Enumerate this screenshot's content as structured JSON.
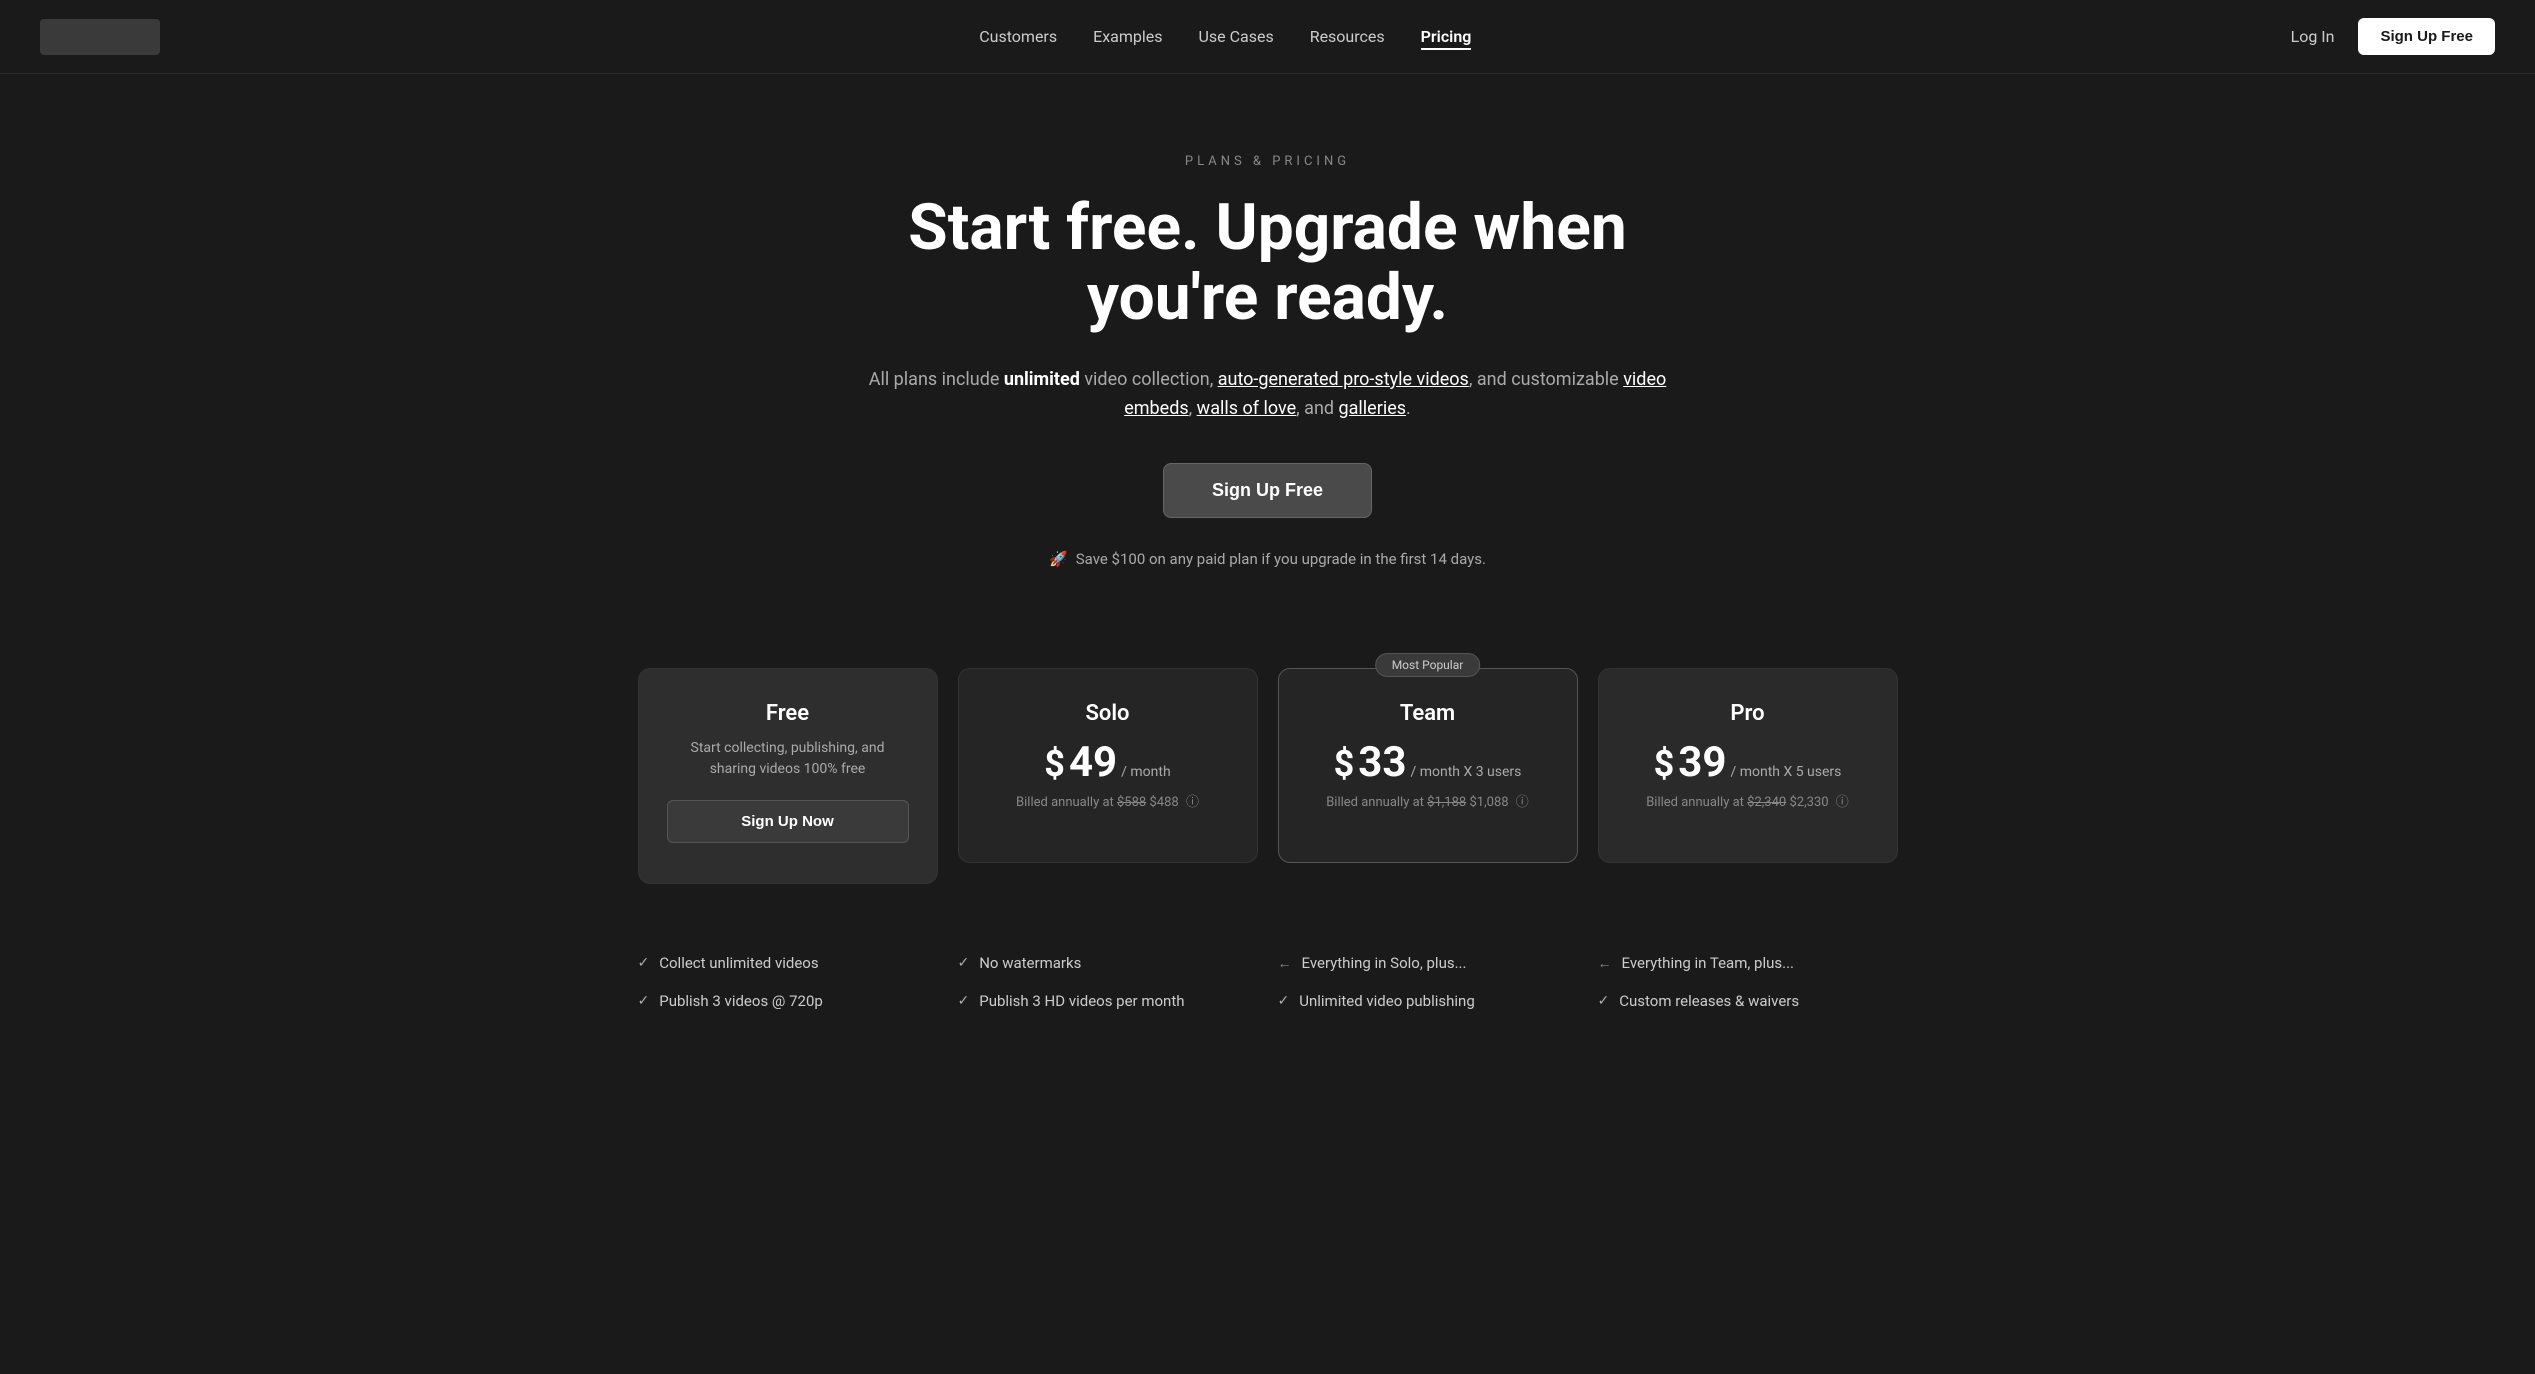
{
  "nav": {
    "logo_alt": "Logo",
    "links": [
      {
        "label": "Customers",
        "active": false
      },
      {
        "label": "Examples",
        "active": false
      },
      {
        "label": "Use Cases",
        "active": false
      },
      {
        "label": "Resources",
        "active": false
      },
      {
        "label": "Pricing",
        "active": true
      }
    ],
    "login_label": "Log In",
    "signup_label": "Sign Up Free"
  },
  "hero": {
    "label": "PLANS & PRICING",
    "title": "Start free. Upgrade when you're ready.",
    "subtitle_plain": "All plans include ",
    "subtitle_bold": "unlimited",
    "subtitle_mid": " video collection, ",
    "subtitle_link1": "auto-generated pro-style videos",
    "subtitle_comma1": ", and customizable ",
    "subtitle_link2": "video embeds",
    "subtitle_comma2": ", ",
    "subtitle_link3": "walls of love",
    "subtitle_comma3": ", and ",
    "subtitle_link4": "galleries",
    "subtitle_end": ".",
    "cta_label": "Sign Up Free",
    "save_note": "Save $100 on any paid plan if you upgrade in the first 14 days.",
    "rocket_emoji": "🚀"
  },
  "pricing": {
    "cards": [
      {
        "id": "free",
        "title": "Free",
        "description": "Start collecting, publishing, and sharing videos 100% free",
        "cta_label": "Sign Up Now",
        "has_price": false,
        "badge": null,
        "billing": null
      },
      {
        "id": "solo",
        "title": "Solo",
        "description": null,
        "cta_label": null,
        "has_price": true,
        "price_amount": "49",
        "price_dollar": "$",
        "price_per": "/ month",
        "badge": null,
        "billing_original": "$588",
        "billing_discounted": "$488",
        "billing_prefix": "Billed annually at "
      },
      {
        "id": "team",
        "title": "Team",
        "description": null,
        "cta_label": null,
        "has_price": true,
        "price_amount": "33",
        "price_dollar": "$",
        "price_per": "/ month X 3 users",
        "badge": "Most Popular",
        "billing_original": "$1,188",
        "billing_discounted": "$1,088",
        "billing_prefix": "Billed annually at "
      },
      {
        "id": "pro",
        "title": "Pro",
        "description": null,
        "cta_label": null,
        "has_price": true,
        "price_amount": "39",
        "price_dollar": "$",
        "price_per": "/ month X 5 users",
        "badge": null,
        "billing_original": "$2,340",
        "billing_discounted": "$2,330",
        "billing_prefix": "Billed annually at "
      }
    ]
  },
  "features": {
    "columns": [
      {
        "plan": "free",
        "items": [
          {
            "text": "Collect unlimited videos",
            "icon": "check"
          },
          {
            "text": "Publish 3 videos @ 720p",
            "icon": "check"
          }
        ]
      },
      {
        "plan": "solo",
        "items": [
          {
            "text": "No watermarks",
            "icon": "check"
          },
          {
            "text": "Publish 3 HD videos per month",
            "icon": "check"
          }
        ]
      },
      {
        "plan": "team",
        "items": [
          {
            "text": "Everything in Solo, plus...",
            "icon": "arrow"
          },
          {
            "text": "Unlimited video publishing",
            "icon": "check"
          }
        ]
      },
      {
        "plan": "pro",
        "items": [
          {
            "text": "Everything in Team, plus...",
            "icon": "arrow"
          },
          {
            "text": "Custom releases & waivers",
            "icon": "check"
          }
        ]
      }
    ]
  }
}
